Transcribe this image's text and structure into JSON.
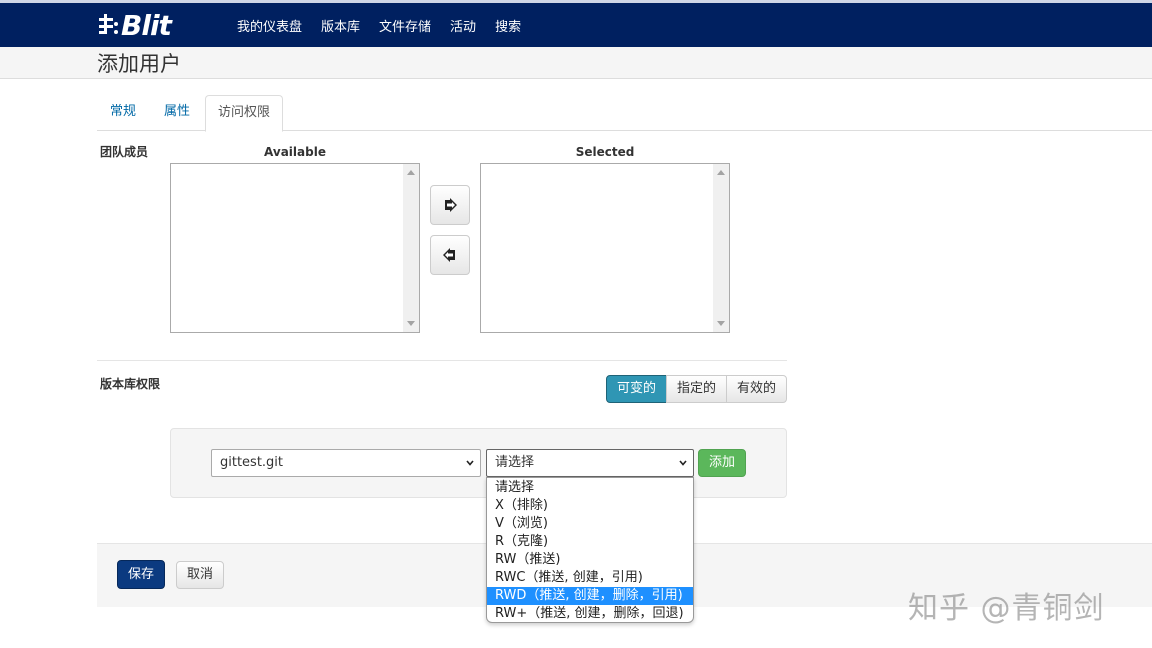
{
  "app": {
    "brand_text": "Blit",
    "nav": [
      "我的仪表盘",
      "版本库",
      "文件存储",
      "活动",
      "搜索"
    ]
  },
  "page": {
    "title": "添加用户"
  },
  "tabs": [
    {
      "label": "常规",
      "active": false
    },
    {
      "label": "属性",
      "active": false
    },
    {
      "label": "访问权限",
      "active": true
    }
  ],
  "team_members": {
    "label": "团队成员",
    "available_title": "Available",
    "selected_title": "Selected",
    "move_right_icon": "arrow-right-icon",
    "move_left_icon": "arrow-left-icon"
  },
  "repo_permissions": {
    "label": "版本库权限",
    "modes": [
      {
        "label": "可变的",
        "active": true
      },
      {
        "label": "指定的",
        "active": false
      },
      {
        "label": "有效的",
        "active": false
      }
    ],
    "repo_select_value": "gittest.git",
    "perm_select_value": "请选择",
    "add_label": "添加",
    "perm_options": [
      {
        "label": "请选择",
        "highlighted": false
      },
      {
        "label": "X（排除)",
        "highlighted": false
      },
      {
        "label": "V（浏览)",
        "highlighted": false
      },
      {
        "label": "R（克隆)",
        "highlighted": false
      },
      {
        "label": "RW（推送)",
        "highlighted": false
      },
      {
        "label": "RWC（推送, 创建，引用)",
        "highlighted": false
      },
      {
        "label": "RWD（推送, 创建，删除，引用)",
        "highlighted": true
      },
      {
        "label": "RW+（推送, 创建，删除，回退)",
        "highlighted": false
      }
    ]
  },
  "footer": {
    "save_label": "保存",
    "cancel_label": "取消"
  },
  "watermark": "知乎 @青铜剑",
  "colors": {
    "navbar": "#002060",
    "active_mode": "#2f96b4",
    "add_button": "#5bb75b",
    "save_button": "#0b3a80",
    "dropdown_highlight": "#1e90ff"
  }
}
